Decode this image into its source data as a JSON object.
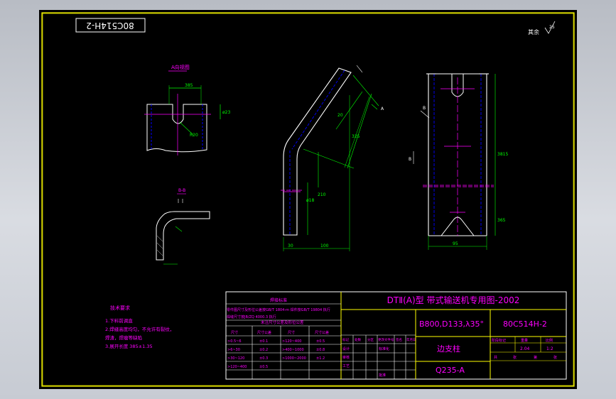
{
  "drawing_number_mirrored": "80C514H-2",
  "corner_label": "其余",
  "corner_roughness": "25",
  "view_a_title": "A向视图",
  "section_bb_title": "B-B",
  "view_label_a": "A",
  "view_label_b": "B",
  "notes": {
    "title": "技术要求",
    "lines": [
      "1.下料前调直",
      "2.焊缝高度均匀，不允许有裂纹，",
      "  焊渣，焊瘤等缺陷",
      "3.展开长度 385±1.35"
    ]
  },
  "title_block": {
    "main_title": "DTⅡ(A)型  带式输送机专用图-2002",
    "spec": "B800,D133,λ35°",
    "drawing_no": "80C514H-2",
    "part_name": "边支柱",
    "material": "Q235-A",
    "welding_header": "焊接标准",
    "welding_lines": [
      "零件图尺寸及形位公差按GB/T 1804-m 焊件按GB/T 19804 执行",
      "焊缝尺寸按JB/ZQ 4000.3 执行"
    ],
    "tol_header": "未注尺寸公差及形位公差",
    "tol_cols": [
      "尺寸",
      "尺寸公差",
      "尺寸",
      "尺寸公差"
    ],
    "tol_rows": [
      [
        ">0.5~6",
        "±0.1",
        ">120~400",
        "±0.5"
      ],
      [
        ">6~30",
        "±0.2",
        ">400~1000",
        "±0.8"
      ],
      [
        ">30~120",
        "±0.3",
        ">1000~2000",
        "±1.2"
      ],
      [
        ">120~400",
        "±0.5",
        "",
        ""
      ]
    ],
    "sig_cols": [
      "标记",
      "处数",
      "分区",
      "更改文件号",
      "签名",
      "年月日"
    ],
    "sig_rows": [
      "设计",
      "审核",
      "工艺",
      "批准"
    ],
    "std_label": "标准化",
    "stage_label": "阶段标记",
    "weight_label": "重量",
    "scale_label": "比例",
    "weight": "2.04",
    "scale": "1:2",
    "sheet_labels": [
      "共",
      "张",
      "第",
      "张"
    ]
  },
  "dimensions": {
    "view_a": [
      "385",
      "ø23",
      "R20"
    ],
    "front": [
      "20",
      "325",
      "210",
      "ø18",
      "30",
      "100"
    ],
    "side": [
      "3815",
      "95",
      "365"
    ]
  }
}
